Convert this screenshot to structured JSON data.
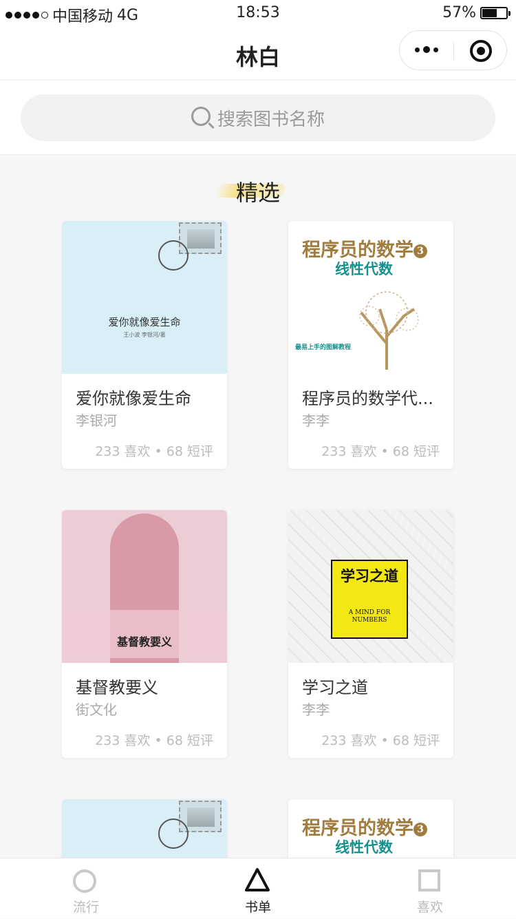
{
  "status": {
    "carrier": "中国移动",
    "network": "4G",
    "time": "18:53",
    "battery": "57%",
    "battery_level": 0.57
  },
  "nav": {
    "title": "林白"
  },
  "search": {
    "placeholder": "搜索图书名称"
  },
  "section": {
    "title": "精选"
  },
  "books": [
    {
      "title": "爱你就像爱生命",
      "author": "李银河",
      "stats": "233 喜欢 • 68 短评",
      "cover": {
        "title": "爱你就像爱生命",
        "sub": "王小波 李银河/著"
      }
    },
    {
      "title": "程序员的数学代...",
      "author": "李李",
      "stats": "233 喜欢 • 68 短评",
      "cover": {
        "title": "程序员的数学",
        "num": "3",
        "sub": "线性代数",
        "tag": "最易上手的图解教程"
      }
    },
    {
      "title": "基督教要义",
      "author": "街文化",
      "stats": "233 喜欢 • 68 短评",
      "cover": {
        "title": "基督教要义"
      }
    },
    {
      "title": "学习之道",
      "author": "李李",
      "stats": "233 喜欢 • 68 短评",
      "cover": {
        "title": "学习之道",
        "sub": "A MIND FOR NUMBERS"
      }
    },
    {
      "cover": {
        "title": ""
      }
    },
    {
      "cover": {
        "title": "程序员的数学",
        "num": "3",
        "sub": "线性代数"
      }
    }
  ],
  "tabs": [
    {
      "label": "流行",
      "icon": "circle-icon"
    },
    {
      "label": "书单",
      "icon": "triangle-icon",
      "active": true
    },
    {
      "label": "喜欢",
      "icon": "square-icon"
    }
  ]
}
